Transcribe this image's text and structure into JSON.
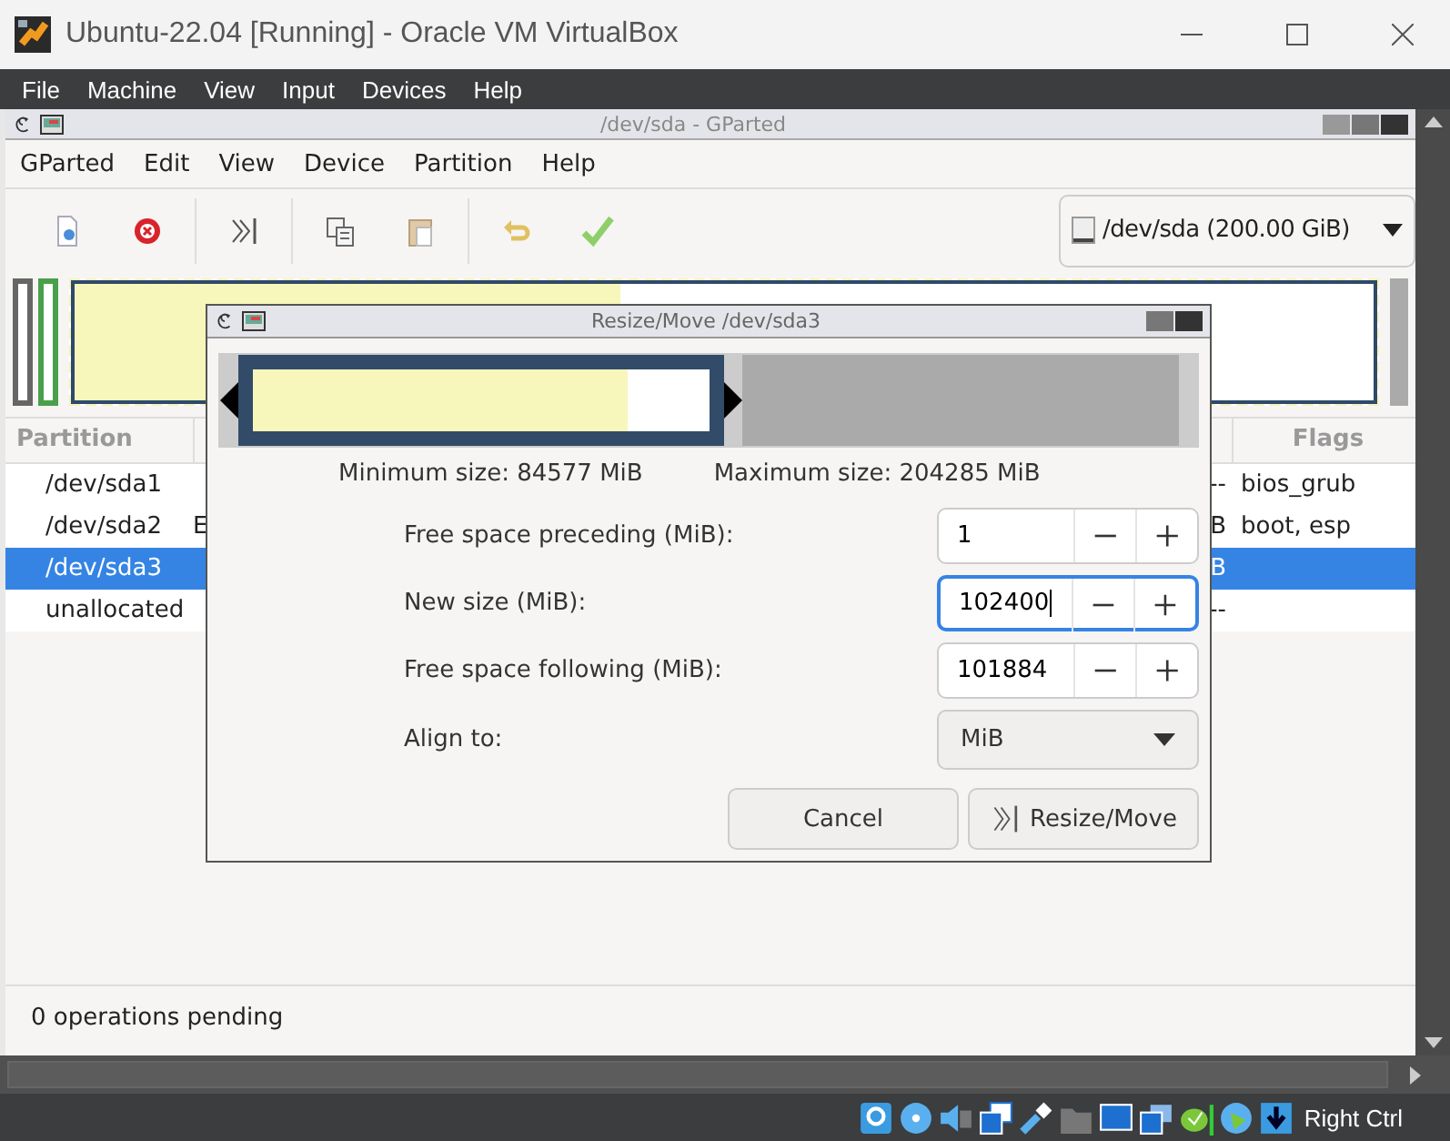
{
  "window": {
    "title": "Ubuntu-22.04 [Running] - Oracle VM VirtualBox"
  },
  "vm_menu": [
    "File",
    "Machine",
    "View",
    "Input",
    "Devices",
    "Help"
  ],
  "gparted": {
    "title": "/dev/sda - GParted",
    "menu": [
      "GParted",
      "Edit",
      "View",
      "Device",
      "Partition",
      "Help"
    ],
    "device": "/dev/sda (200.00 GiB)",
    "disk_map": {
      "level": 0.42
    },
    "table": {
      "columns": [
        "Partition",
        "Flags"
      ],
      "rows": [
        {
          "partition": "/dev/sda1",
          "column_3": "--",
          "flags": "bios_grub",
          "selected": false
        },
        {
          "partition": "/dev/sda2",
          "column_2": "E",
          "column_3": "B",
          "flags": "boot, esp",
          "selected": false
        },
        {
          "partition": "/dev/sda3",
          "column_3": "B",
          "selected": true
        },
        {
          "partition": "unallocated",
          "column_3": "--",
          "selected": false
        }
      ]
    },
    "status": "0 operations pending"
  },
  "dialog": {
    "title": "Resize/Move /dev/sda3",
    "graph": {
      "level": 0.82
    },
    "minimum": "Minimum size: 84577 MiB",
    "maximum": "Maximum size: 204285 MiB",
    "fields": [
      {
        "label": "Free space preceding (MiB):",
        "value": "1",
        "focused": false
      },
      {
        "label": "New size (MiB):",
        "value": "102400",
        "focused": true
      },
      {
        "label": "Free space following (MiB):",
        "value": "101884",
        "focused": false
      }
    ],
    "align": {
      "label": "Align to:",
      "value": "MiB"
    },
    "buttons": [
      {
        "label": "Cancel",
        "kind": "plain"
      },
      {
        "label": "Resize/Move",
        "kind": "resize"
      }
    ]
  },
  "status_bar": {
    "host_key": "Right Ctrl"
  }
}
